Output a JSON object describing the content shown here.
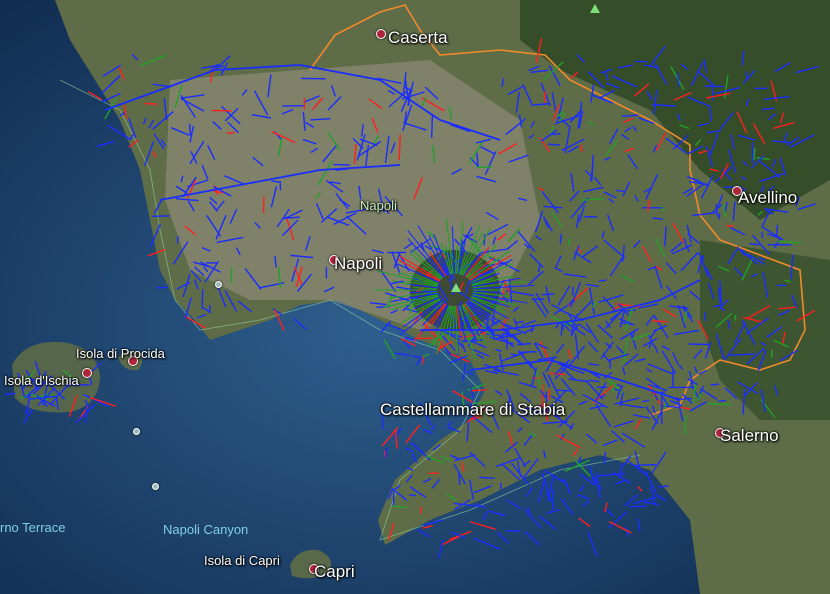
{
  "map": {
    "colors": {
      "sea_deep": "#0b2140",
      "sea_shallow": "#2b5c8a",
      "land": "#5b6b45",
      "urban": "#8c8a7c",
      "forest": "#2f4a25",
      "boundary": "#f08a2a",
      "network_blue": "#1a2dff",
      "network_red": "#ff1f1f",
      "network_green": "#22a22a"
    },
    "labels": {
      "caserta": "Caserta",
      "avellino": "Avellino",
      "napoli": "Napoli",
      "napoli_district": "Napoli",
      "castellammare": "Castellammare di Stabia",
      "salerno": "Salerno",
      "capri": "Capri",
      "isola_capri": "Isola di Capri",
      "isola_ischia": "Isola d'Ischia",
      "isola_procida": "Isola di Procida",
      "napoli_canyon": "Napoli Canyon",
      "terrace": "rno Terrace"
    }
  }
}
